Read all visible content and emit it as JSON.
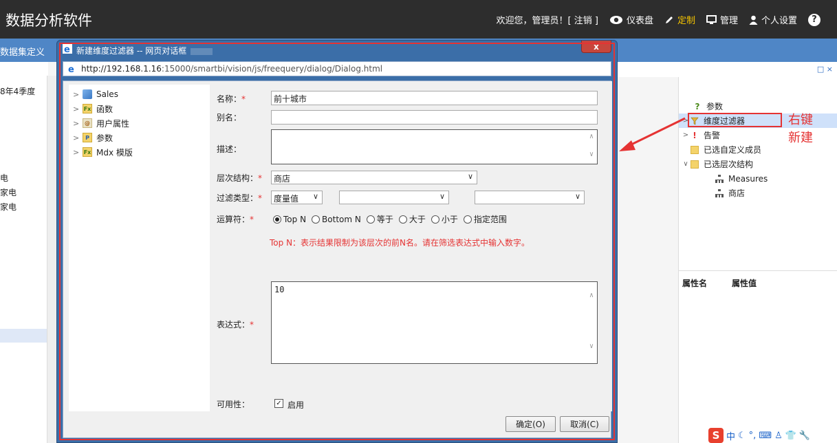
{
  "app": {
    "title": "数据分析软件",
    "nav": {
      "welcome": "欢迎您，管理员！[ 注销 ]",
      "dashboard": "仪表盘",
      "custom": "定制",
      "manage": "管理",
      "settings": "个人设置",
      "help": "?"
    },
    "accent_color": "#f5c400"
  },
  "tabbar": {
    "first_tab": "数据集定义"
  },
  "left_panel": {
    "rows": [
      "8年4季度",
      "电",
      "家电",
      "家电"
    ]
  },
  "right_panel": {
    "window_controls": "□ ×",
    "tree": [
      {
        "label": "参数",
        "icon": "question-icon",
        "expandable": false
      },
      {
        "label": "维度过滤器",
        "icon": "filter-icon",
        "expandable": true,
        "selected": true
      },
      {
        "label": "告警",
        "icon": "alert-icon",
        "expandable": true
      },
      {
        "label": "已选自定义成员",
        "icon": "folder-icon",
        "expandable": false
      },
      {
        "label": "已选层次结构",
        "icon": "folder-icon",
        "expandable": true,
        "expanded": true
      },
      {
        "label": "Measures",
        "icon": "hierarchy-icon",
        "child": true
      },
      {
        "label": "商店",
        "icon": "hierarchy-icon",
        "child": true
      }
    ],
    "annotation": [
      "右键",
      "新建"
    ],
    "properties": {
      "name_header": "属性名",
      "value_header": "属性值"
    }
  },
  "dialog": {
    "title": "新建维度过滤器 -- 网页对话框",
    "close": "x",
    "url_host": "http://192.168.1.16",
    "url_path": ":15000/smartbi/vision/js/freequery/dialog/Dialog.html",
    "tree": [
      {
        "label": "Sales",
        "icon": "cube-icon"
      },
      {
        "label": "函数",
        "icon": "function-icon"
      },
      {
        "label": "用户属性",
        "icon": "user-attribute-icon"
      },
      {
        "label": "参数",
        "icon": "parameter-icon"
      },
      {
        "label": "Mdx 模版",
        "icon": "mdx-template-icon"
      }
    ],
    "form": {
      "name_label": "名称：",
      "name_value": "前十城市",
      "alias_label": "别名：",
      "alias_value": "",
      "desc_label": "描述：",
      "hierarchy_label": "层次结构：",
      "hierarchy_value": "商店",
      "filter_type_label": "过滤类型：",
      "filter_type_value": "度量值",
      "filter_type_2": "",
      "filter_type_3": "",
      "operator_label": "运算符：",
      "operators": [
        {
          "label": "Top N",
          "checked": true
        },
        {
          "label": "Bottom N",
          "checked": false
        },
        {
          "label": "等于",
          "checked": false
        },
        {
          "label": "大于",
          "checked": false
        },
        {
          "label": "小于",
          "checked": false
        },
        {
          "label": "指定范围",
          "checked": false
        }
      ],
      "hint": "Top N：表示结果限制为该层次的前N名。请在筛选表达式中输入数字。",
      "expression_label": "表达式：",
      "expression_value": "10",
      "availability_label": "可用性：",
      "enabled_label": "启用",
      "enabled": true,
      "required_mark": "*"
    },
    "buttons": {
      "ok": "确定(O)",
      "cancel": "取消(C)"
    }
  },
  "ime": {
    "lang": "中"
  }
}
